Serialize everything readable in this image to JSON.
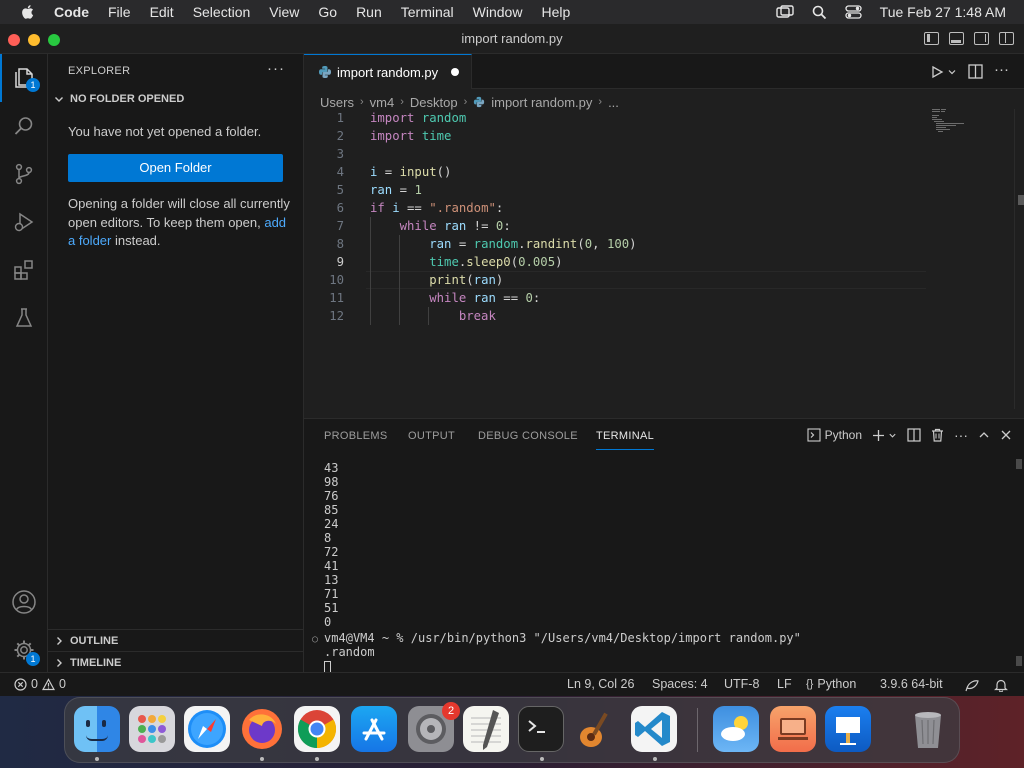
{
  "menubar": {
    "app": "Code",
    "items": [
      "File",
      "Edit",
      "Selection",
      "View",
      "Go",
      "Run",
      "Terminal",
      "Window",
      "Help"
    ],
    "clock": "Tue Feb 27  1:48 AM"
  },
  "window": {
    "title": "import random.py"
  },
  "activitybar": {
    "explorer_badge": "1",
    "accounts_badge": "1"
  },
  "sidebar": {
    "title": "EXPLORER",
    "more": "···",
    "section": "NO FOLDER OPENED",
    "message": "You have not yet opened a folder.",
    "open_folder": "Open Folder",
    "note_part1": "Opening a folder will close all currently open editors. To keep them open, ",
    "note_link": "add a folder",
    "note_part2": " instead.",
    "outline": "OUTLINE",
    "timeline": "TIMELINE"
  },
  "editor": {
    "tab_label": "import random.py",
    "breadcrumb": [
      "Users",
      "vm4",
      "Desktop",
      "import random.py",
      "..."
    ],
    "lines": [
      {
        "n": "1",
        "tokens": [
          [
            "kw2",
            "import"
          ],
          [
            "op",
            " "
          ],
          [
            "mod",
            "random"
          ]
        ]
      },
      {
        "n": "2",
        "tokens": [
          [
            "kw2",
            "import"
          ],
          [
            "op",
            " "
          ],
          [
            "mod",
            "time"
          ]
        ]
      },
      {
        "n": "3",
        "tokens": []
      },
      {
        "n": "4",
        "tokens": [
          [
            "var",
            "i"
          ],
          [
            "op",
            " = "
          ],
          [
            "fn",
            "input"
          ],
          [
            "op",
            "()"
          ]
        ]
      },
      {
        "n": "5",
        "tokens": [
          [
            "var",
            "ran"
          ],
          [
            "op",
            " = "
          ],
          [
            "num",
            "1"
          ]
        ]
      },
      {
        "n": "6",
        "tokens": [
          [
            "kw2",
            "if"
          ],
          [
            "op",
            " "
          ],
          [
            "var",
            "i"
          ],
          [
            "op",
            " == "
          ],
          [
            "str",
            "\".random\""
          ],
          [
            "op",
            ":"
          ]
        ]
      },
      {
        "n": "7",
        "tokens": [
          [
            "op",
            "    "
          ],
          [
            "kw2",
            "while"
          ],
          [
            "op",
            " "
          ],
          [
            "var",
            "ran"
          ],
          [
            "op",
            " != "
          ],
          [
            "num",
            "0"
          ],
          [
            "op",
            ":"
          ]
        ]
      },
      {
        "n": "8",
        "tokens": [
          [
            "op",
            "        "
          ],
          [
            "var",
            "ran"
          ],
          [
            "op",
            " = "
          ],
          [
            "mod",
            "random"
          ],
          [
            "op",
            "."
          ],
          [
            "fn",
            "randint"
          ],
          [
            "op",
            "("
          ],
          [
            "num",
            "0"
          ],
          [
            "op",
            ", "
          ],
          [
            "num",
            "100"
          ],
          [
            "op",
            ")"
          ]
        ]
      },
      {
        "n": "9",
        "tokens": [
          [
            "op",
            "        "
          ],
          [
            "mod",
            "time"
          ],
          [
            "op",
            "."
          ],
          [
            "fn",
            "sleep0"
          ],
          [
            "op",
            "("
          ],
          [
            "num",
            "0.005"
          ],
          [
            "op",
            ")"
          ]
        ]
      },
      {
        "n": "10",
        "tokens": [
          [
            "op",
            "        "
          ],
          [
            "fn",
            "print"
          ],
          [
            "op",
            "("
          ],
          [
            "var",
            "ran"
          ],
          [
            "op",
            ")"
          ]
        ]
      },
      {
        "n": "11",
        "tokens": [
          [
            "op",
            "        "
          ],
          [
            "kw2",
            "while"
          ],
          [
            "op",
            " "
          ],
          [
            "var",
            "ran"
          ],
          [
            "op",
            " == "
          ],
          [
            "num",
            "0"
          ],
          [
            "op",
            ":"
          ]
        ]
      },
      {
        "n": "12",
        "tokens": [
          [
            "op",
            "            "
          ],
          [
            "kw2",
            "break"
          ]
        ]
      }
    ],
    "active_line": "9"
  },
  "panel": {
    "tabs": [
      "PROBLEMS",
      "OUTPUT",
      "DEBUG CONSOLE",
      "TERMINAL"
    ],
    "active_tab": "TERMINAL",
    "terminal_profile": "Python",
    "output": [
      "43",
      "98",
      "76",
      "85",
      "24",
      "8",
      "72",
      "41",
      "13",
      "71",
      "51",
      "0"
    ],
    "prompt": "vm4@VM4 ~ % /usr/bin/python3 \"/Users/vm4/Desktop/import random.py\"",
    "input_echo": ".random"
  },
  "statusbar": {
    "errors": "0",
    "warnings": "0",
    "position": "Ln 9, Col 26",
    "spaces": "Spaces: 4",
    "encoding": "UTF-8",
    "eol": "LF",
    "language": "Python",
    "interpreter": "3.9.6 64-bit"
  },
  "dock": {
    "settings_badge": "2",
    "apps": [
      "finder-icon",
      "launchpad-icon",
      "safari-icon",
      "firefox-icon",
      "chrome-icon",
      "app-store-icon",
      "system-settings-icon",
      "textedit-icon",
      "terminal-icon",
      "garageband-icon",
      "vscode-icon",
      "weather-icon",
      "keynote-icon",
      "screen-sharing-icon",
      "trash-icon"
    ]
  },
  "colors": {
    "accent": "#0078d4",
    "badge_red": "#e5382e",
    "background": "#1f1f1f"
  }
}
